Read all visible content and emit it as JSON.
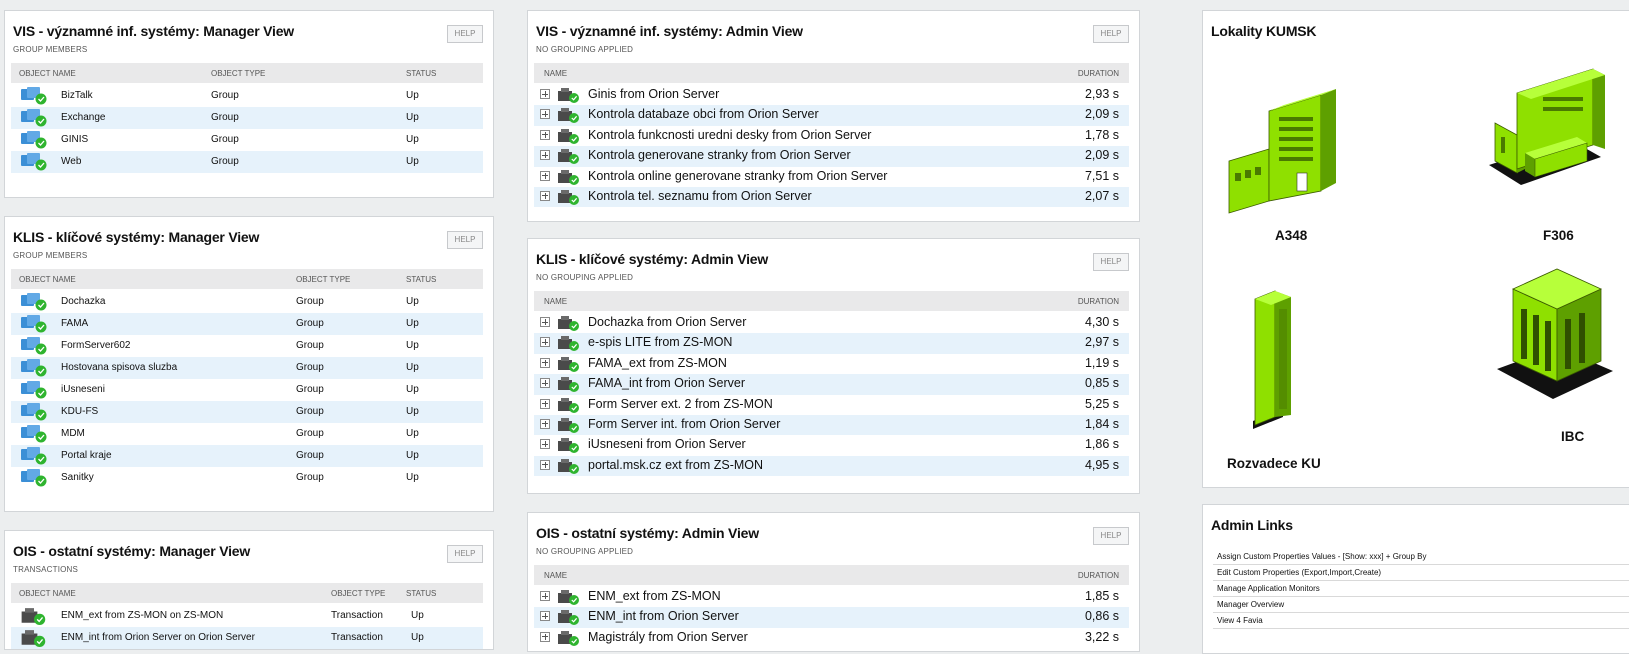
{
  "vis_manager": {
    "title": "VIS - významné inf. systémy: Manager View",
    "subtitle": "GROUP MEMBERS",
    "help": "HELP",
    "columns": {
      "name": "OBJECT NAME",
      "type": "OBJECT TYPE",
      "status": "STATUS"
    },
    "rows": [
      {
        "name": "BizTalk",
        "type": "Group",
        "status": "Up"
      },
      {
        "name": "Exchange",
        "type": "Group",
        "status": "Up"
      },
      {
        "name": "GINIS",
        "type": "Group",
        "status": "Up"
      },
      {
        "name": "Web",
        "type": "Group",
        "status": "Up"
      }
    ]
  },
  "klis_manager": {
    "title": "KLIS - klíčové systémy: Manager View",
    "subtitle": "GROUP MEMBERS",
    "help": "HELP",
    "columns": {
      "name": "OBJECT NAME",
      "type": "OBJECT TYPE",
      "status": "STATUS"
    },
    "rows": [
      {
        "name": "Dochazka",
        "type": "Group",
        "status": "Up"
      },
      {
        "name": "FAMA",
        "type": "Group",
        "status": "Up"
      },
      {
        "name": "FormServer602",
        "type": "Group",
        "status": "Up"
      },
      {
        "name": "Hostovana spisova sluzba",
        "type": "Group",
        "status": "Up"
      },
      {
        "name": "iUsneseni",
        "type": "Group",
        "status": "Up"
      },
      {
        "name": "KDU-FS",
        "type": "Group",
        "status": "Up"
      },
      {
        "name": "MDM",
        "type": "Group",
        "status": "Up"
      },
      {
        "name": "Portal kraje",
        "type": "Group",
        "status": "Up"
      },
      {
        "name": "Sanitky",
        "type": "Group",
        "status": "Up"
      }
    ]
  },
  "ois_manager": {
    "title": "OIS - ostatní systémy: Manager View",
    "subtitle": "TRANSACTIONS",
    "help": "HELP",
    "columns": {
      "name": "OBJECT NAME",
      "type": "OBJECT TYPE",
      "status": "STATUS"
    },
    "rows": [
      {
        "name": "ENM_ext from ZS-MON on ZS-MON",
        "type": "Transaction",
        "status": "Up"
      },
      {
        "name": "ENM_int from Orion Server on Orion Server",
        "type": "Transaction",
        "status": "Up"
      }
    ]
  },
  "vis_admin": {
    "title": "VIS - významné inf. systémy: Admin View",
    "subtitle": "NO GROUPING APPLIED",
    "help": "HELP",
    "columns": {
      "name": "NAME",
      "duration": "DURATION"
    },
    "rows": [
      {
        "name": "Ginis from Orion Server",
        "duration": "2,93 s"
      },
      {
        "name": "Kontrola databaze obci from Orion Server",
        "duration": "2,09 s"
      },
      {
        "name": "Kontrola funkcnosti uredni desky from Orion Server",
        "duration": "1,78 s"
      },
      {
        "name": "Kontrola generovane stranky from Orion Server",
        "duration": "2,09 s"
      },
      {
        "name": "Kontrola online generovane stranky from Orion Server",
        "duration": "7,51 s"
      },
      {
        "name": "Kontrola tel. seznamu from Orion Server",
        "duration": "2,07 s"
      }
    ]
  },
  "klis_admin": {
    "title": "KLIS - klíčové systémy: Admin View",
    "subtitle": "NO GROUPING APPLIED",
    "help": "HELP",
    "columns": {
      "name": "NAME",
      "duration": "DURATION"
    },
    "rows": [
      {
        "name": "Dochazka from Orion Server",
        "duration": "4,30 s"
      },
      {
        "name": "e-spis LITE from ZS-MON",
        "duration": "2,97 s"
      },
      {
        "name": "FAMA_ext from ZS-MON",
        "duration": "1,19 s"
      },
      {
        "name": "FAMA_int from Orion Server",
        "duration": "0,85 s"
      },
      {
        "name": "Form Server ext. 2 from ZS-MON",
        "duration": "5,25 s"
      },
      {
        "name": "Form Server int. from Orion Server",
        "duration": "1,84 s"
      },
      {
        "name": "iUsneseni from Orion Server",
        "duration": "1,86 s"
      },
      {
        "name": "portal.msk.cz ext from ZS-MON",
        "duration": "4,95 s"
      }
    ]
  },
  "ois_admin": {
    "title": "OIS - ostatní systémy: Admin View",
    "subtitle": "NO GROUPING APPLIED",
    "help": "HELP",
    "columns": {
      "name": "NAME",
      "duration": "DURATION"
    },
    "rows": [
      {
        "name": "ENM_ext from ZS-MON",
        "duration": "1,85 s"
      },
      {
        "name": "ENM_int from Orion Server",
        "duration": "0,86 s"
      },
      {
        "name": "Magistrály from Orion Server",
        "duration": "3,22 s"
      }
    ]
  },
  "lokality": {
    "title": "Lokality KUMSK",
    "locations": {
      "a": "A348",
      "b": "F306",
      "c": "Rozvadece KU",
      "d": "IBC"
    }
  },
  "admin_links": {
    "title": "Admin Links",
    "links": [
      "Assign Custom Properties Values - [Show: xxx] + Group By",
      "Edit Custom Properties (Export,Import,Create)",
      "Manage Application Monitors",
      "Manager Overview",
      "View 4 Favia"
    ]
  },
  "colors": {
    "building_green": "#8fe000",
    "row_alt": "#e6f2fb",
    "group_blue": "#3b8fd6",
    "status_green": "#2fb42f"
  }
}
